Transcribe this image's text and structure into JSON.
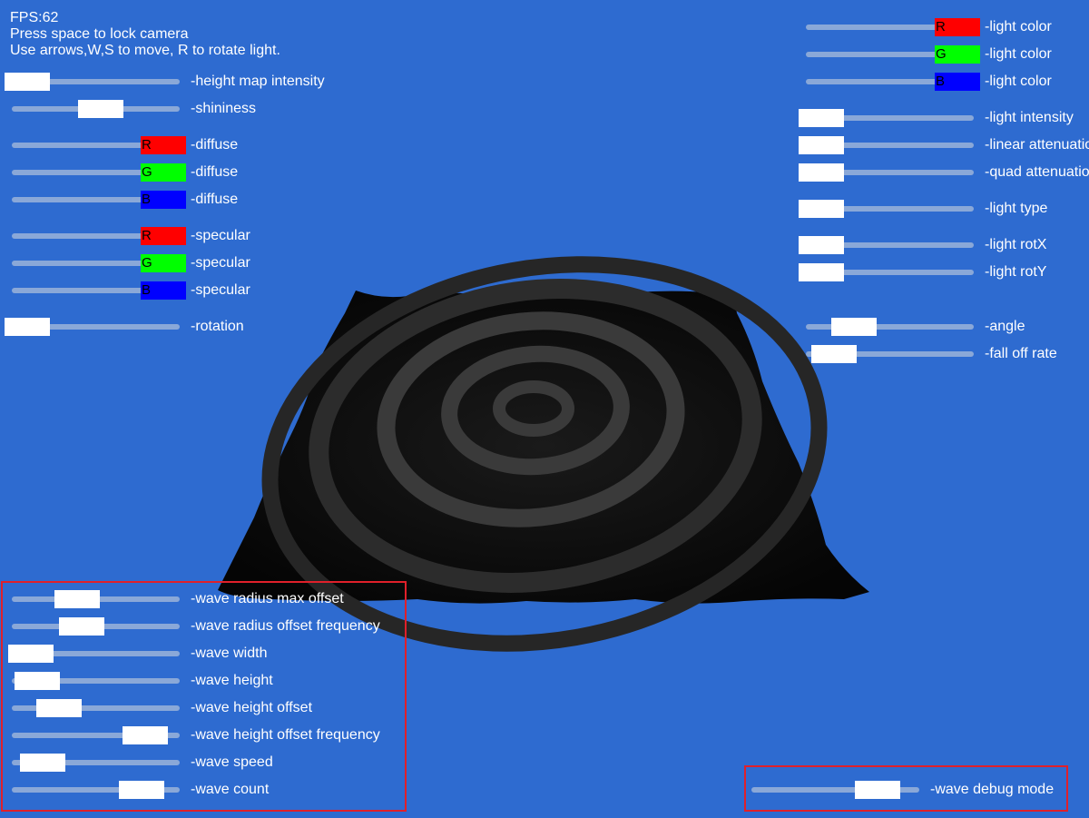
{
  "hud": {
    "fps": "FPS:62",
    "hint_camera": "Press space to lock camera",
    "hint_move": "Use arrows,W,S to move, R to rotate light."
  },
  "left_top": [
    {
      "label": "-height map intensity",
      "value": 0.0
    },
    {
      "label": "-shininess",
      "value": 0.54
    },
    {
      "label": "-diffuse",
      "channel": "R",
      "value": 1.0
    },
    {
      "label": "-diffuse",
      "channel": "G",
      "value": 1.0
    },
    {
      "label": "-diffuse",
      "channel": "B",
      "value": 1.0
    },
    {
      "label": "-specular",
      "channel": "R",
      "value": 1.0
    },
    {
      "label": "-specular",
      "channel": "G",
      "value": 1.0
    },
    {
      "label": "-specular",
      "channel": "B",
      "value": 1.0
    },
    {
      "label": "-rotation",
      "value": 0.0
    }
  ],
  "right_top": [
    {
      "label": "-light color",
      "channel": "R",
      "value": 1.0
    },
    {
      "label": "-light color",
      "channel": "G",
      "value": 1.0
    },
    {
      "label": "-light color",
      "channel": "B",
      "value": 1.0
    },
    {
      "label": "-light intensity",
      "value": 0.0
    },
    {
      "label": "-linear attenuation",
      "value": 0.0
    },
    {
      "label": "-quad attenuation",
      "value": 0.0
    },
    {
      "label": "-light type",
      "value": 0.0
    },
    {
      "label": "-light rotX",
      "value": 0.0
    },
    {
      "label": "-light rotY",
      "value": 0.0
    },
    {
      "label": "-angle",
      "value": 0.24
    },
    {
      "label": "-fall off rate",
      "value": 0.09
    }
  ],
  "wave_panel": [
    {
      "label": "-wave radius max offset",
      "value": 0.39
    },
    {
      "label": "-wave radius offset frequency",
      "value": 0.43
    },
    {
      "label": "-wave width",
      "value": 0.0
    },
    {
      "label": "-wave height",
      "value": 0.05
    },
    {
      "label": "-wave height offset",
      "value": 0.24
    },
    {
      "label": "-wave height offset frequency",
      "value": 0.96
    },
    {
      "label": "-wave speed",
      "value": 0.1
    },
    {
      "label": "-wave count",
      "value": 0.93
    }
  ],
  "debug_panel": [
    {
      "label": "-wave debug mode",
      "value": 0.9
    }
  ],
  "colors": {
    "background": "#2e6bd0",
    "panel_border": "#e0202a",
    "channel_r": "#ff0000",
    "channel_g": "#00ff00",
    "channel_b": "#0000ff"
  }
}
